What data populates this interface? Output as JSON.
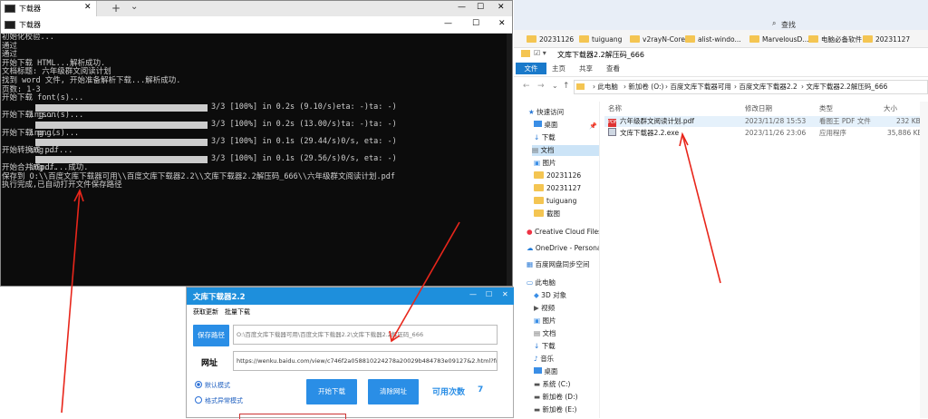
{
  "terminal": {
    "tab_label": "下载器",
    "window_title": "下载器",
    "new_tab": "+",
    "dropdown": "⌄",
    "controls": {
      "minimize": "—",
      "maximize": "☐",
      "close": "✕"
    },
    "lines": [
      "初始化校验...",
      "通过",
      "通过",
      "开始下载 HTML...解析成功.",
      "文档标题: 六年级群文阅读计划",
      "找到 word 文件, 开始准备解析下载...解析成功.",
      "页数: 1-3",
      "开始下载 font(s)..."
    ],
    "progress": [
      {
        "label": "ing...",
        "stats": "3/3 [100%] in 0.2s (9.10/s)eta: -)ta: -)",
        "after": "开始下载 json(s)..."
      },
      {
        "label": "ing...",
        "stats": "3/3 [100%] in 0.2s (13.00/s)ta: -)ta: -)",
        "after": "开始下载 png(s)..."
      },
      {
        "label": "ing...",
        "stats": "3/3 [100%] in 0.1s (29.44/s)0/s, eta: -)",
        "after": "开始转换成 pdf..."
      },
      {
        "label": "ing...",
        "stats": "3/3 [100%] in 0.1s (29.56/s)0/s, eta: -)",
        "after": "开始合并成pdf...成功."
      }
    ],
    "save_line": "保存到 O:\\\\百度文库下载器可用\\\\百度文库下载器2.2\\\\文库下载器2.2解压码_666\\\\六年级群文阅读计划.pdf",
    "done_line": "执行完成,已自动打开文件保存路径"
  },
  "app": {
    "title": "文库下载器2.2",
    "menu": [
      "获取更新",
      "批量下载"
    ],
    "save_path_button": "保存路径",
    "save_path_value": "O:\\百度文库下载器可用\\百度文库下载器2.2\\文库下载器2.2解压码_666",
    "url_label": "网址",
    "url_value": "https://wenku.baidu.com/view/c746f2a058810224278a20029b484783e09127&2.html?fr=hp_d",
    "mode_default": "默认模式",
    "mode_fallback": "格式异常模式",
    "start_button": "开始下载",
    "clear_button": "清除网址",
    "remaining_label": "可用次数",
    "remaining_value": "7",
    "controls": {
      "minimize": "—",
      "maximize": "☐",
      "close": "✕"
    }
  },
  "explorer": {
    "search_label": "查找",
    "bookmarks": [
      "20231126",
      "tuiguang",
      "v2rayN-Core",
      "alist-windo...",
      "MarvelousD...",
      "电脑必备软件",
      "20231127"
    ],
    "window_title": "文库下载器2.2解压码_666",
    "ribbon_tabs": [
      "文件",
      "主页",
      "共享",
      "查看"
    ],
    "breadcrumb": [
      "此电脑",
      "新加卷 (O:)",
      "百度文库下载器可用",
      "百度文库下载器2.2",
      "文库下载器2.2解压码_666"
    ],
    "quick_access_label": "快速访问",
    "sidebar": [
      "桌面",
      "下载",
      "文档",
      "图片",
      "20231126",
      "20231127",
      "tuiguang",
      "截图",
      "Creative Cloud Files",
      "OneDrive - Persona",
      "百度网盘同步空间",
      "此电脑",
      "3D 对象",
      "视频",
      "图片",
      "文档",
      "下载",
      "音乐",
      "桌面",
      "系统 (C:)",
      "新加卷 (D:)",
      "新加卷 (E:)"
    ],
    "columns": [
      "名称",
      "修改日期",
      "类型",
      "大小"
    ],
    "files": [
      {
        "name": "六年级群文阅读计划.pdf",
        "date": "2023/11/28 15:53",
        "type": "看图王 PDF 文件",
        "size": "232 KB",
        "icon": "pdf-icon"
      },
      {
        "name": "文库下载器2.2.exe",
        "date": "2023/11/26 23:06",
        "type": "应用程序",
        "size": "35,886 KB",
        "icon": "exe-icon"
      }
    ]
  }
}
